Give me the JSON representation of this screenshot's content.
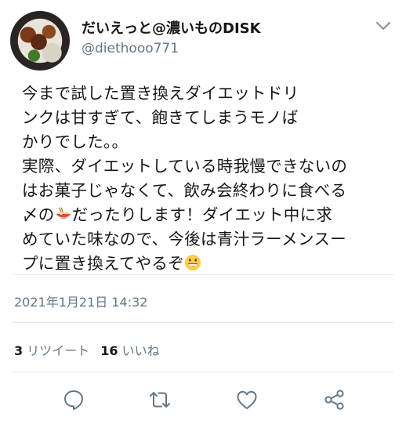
{
  "user": {
    "display_name": "だいえっと@濃いものDISK",
    "handle": "@diethooo771",
    "avatar_icon": "food-photo-avatar"
  },
  "tweet": {
    "lines": [
      "今まで試した置き換えダイエットドリ",
      "ンクは甘すぎて、飽きてしまうモノば",
      "かりでした。。",
      "実際、ダイエットしている時我慢できないの",
      "はお菓子じゃなくて、飲み会終わりに食べる",
      [
        "〆の",
        "だったりします！ダイエット中に求"
      ],
      "めていた味なので、今後は青汁ラーメンスー",
      [
        "プに置き換えてやるぞ",
        ""
      ]
    ],
    "emoji_icons": [
      "ramen-emoji",
      "grinning-face-emoji"
    ]
  },
  "timestamp": "2021年1月21日 14:32",
  "stats": {
    "retweets_count": "3",
    "retweets_label": "リツイート",
    "likes_count": "16",
    "likes_label": "いいね"
  },
  "actions": {
    "icons": [
      "reply-icon",
      "retweet-icon",
      "like-icon",
      "share-icon"
    ]
  },
  "colors": {
    "text": "#14171a",
    "secondary": "#657786",
    "divider": "#e1e8ed",
    "icon": "#657786"
  }
}
